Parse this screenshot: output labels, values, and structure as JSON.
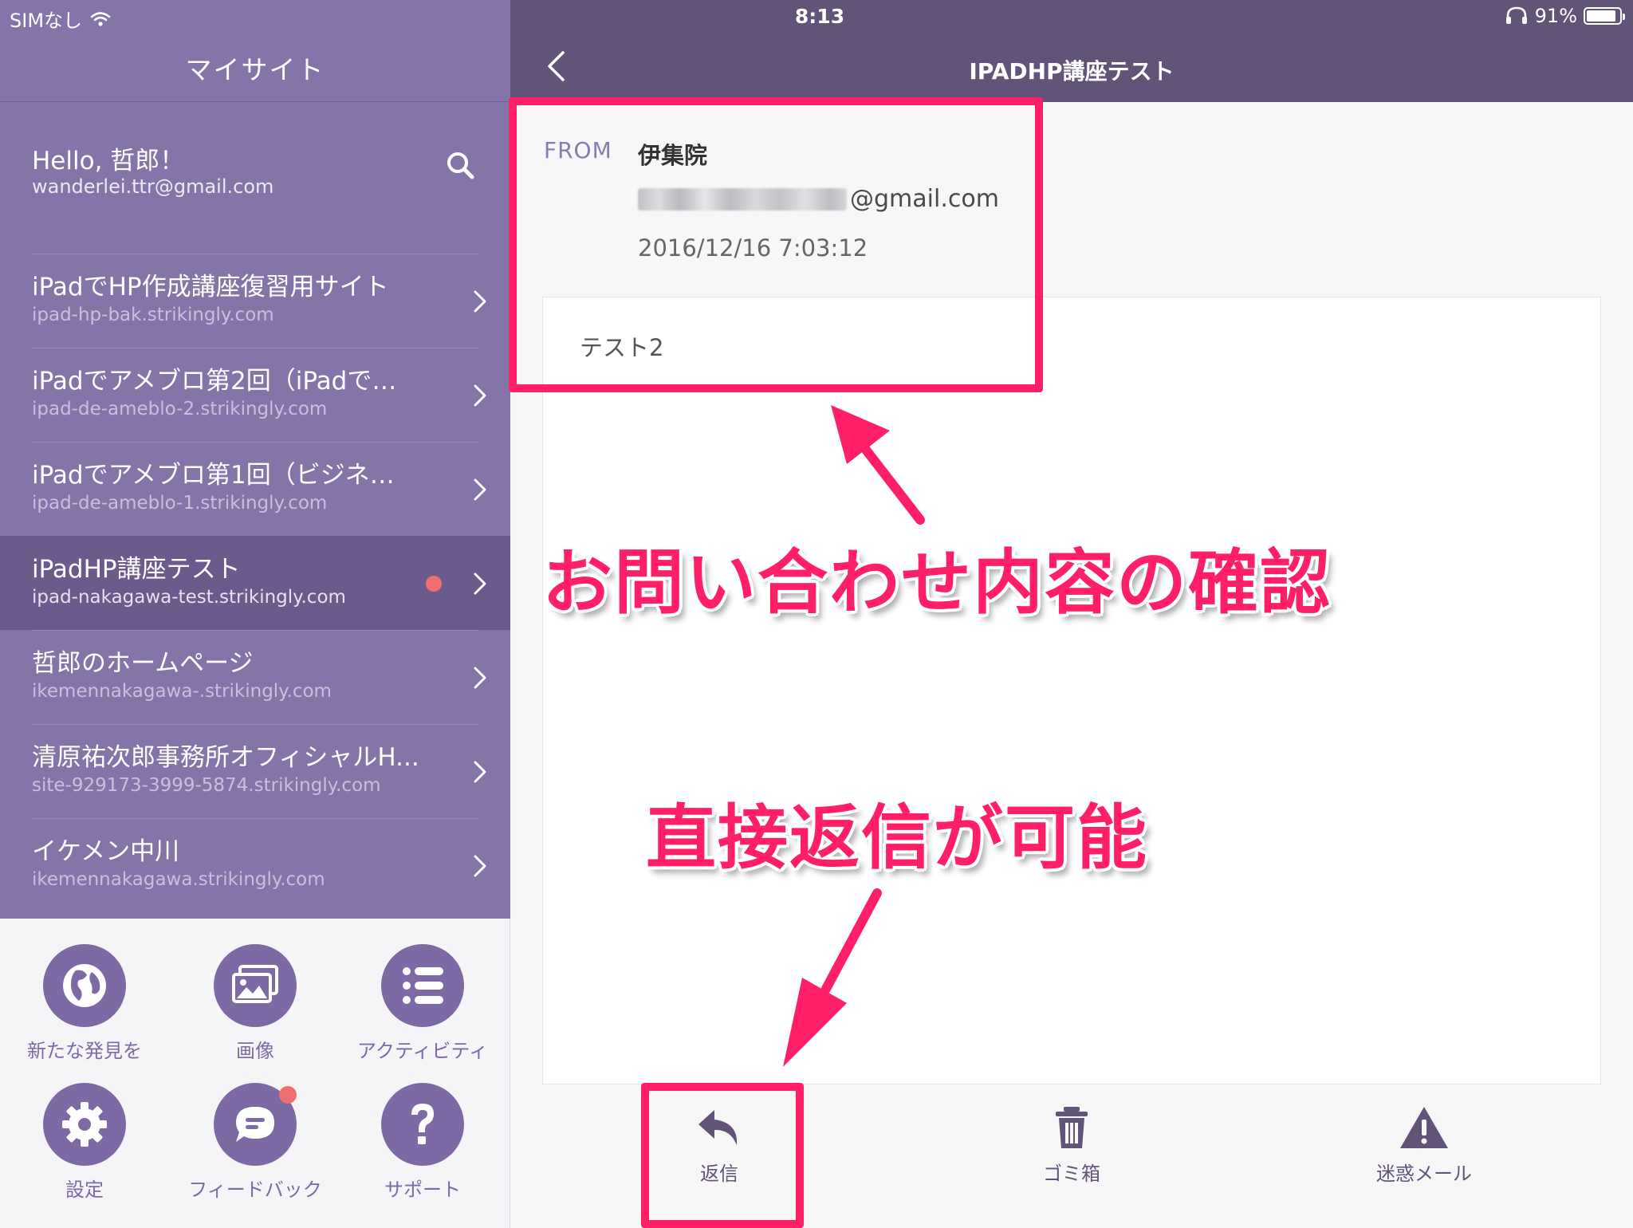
{
  "status": {
    "carrier": "SIMなし",
    "time": "8:13",
    "battery": "91%",
    "battery_fraction": 0.91
  },
  "sidebar": {
    "title": "マイサイト",
    "greeting": "Hello, 哲郎！",
    "email": "wanderlei.ttr@gmail.com",
    "sites": [
      {
        "name": "iPadでHP作成講座復習用サイト",
        "url": "ipad-hp-bak.strikingly.com",
        "active": false,
        "notify": false
      },
      {
        "name": "iPadでアメブロ第2回（iPadで…",
        "url": "ipad-de-ameblo-2.strikingly.com",
        "active": false,
        "notify": false
      },
      {
        "name": "iPadでアメブロ第1回（ビジネ…",
        "url": "ipad-de-ameblo-1.strikingly.com",
        "active": false,
        "notify": false
      },
      {
        "name": "iPadHP講座テスト",
        "url": "ipad-nakagawa-test.strikingly.com",
        "active": true,
        "notify": true
      },
      {
        "name": "哲郎のホームページ",
        "url": "ikemennakagawa-.strikingly.com",
        "active": false,
        "notify": false
      },
      {
        "name": "清原祐次郎事務所オフィシャルH...",
        "url": "site-929173-3999-5874.strikingly.com",
        "active": false,
        "notify": false
      },
      {
        "name": "イケメン中川",
        "url": "ikemennakagawa.strikingly.com",
        "active": false,
        "notify": false
      }
    ],
    "dock": [
      {
        "label": "新たな発見を",
        "icon": "globe-icon"
      },
      {
        "label": "画像",
        "icon": "images-icon"
      },
      {
        "label": "アクティビティ",
        "icon": "activity-list-icon"
      },
      {
        "label": "設定",
        "icon": "gear-icon"
      },
      {
        "label": "フィードバック",
        "icon": "chat-bubble-icon"
      },
      {
        "label": "サポート",
        "icon": "question-icon"
      }
    ]
  },
  "detail": {
    "title": "IPADHP講座テスト",
    "from_label": "FROM",
    "sender_name": "伊集院",
    "sender_email_suffix": "@gmail.com",
    "date": "2016/12/16 7:03:12",
    "message": "テスト2",
    "actions": [
      {
        "label": "返信",
        "icon": "reply-icon"
      },
      {
        "label": "ゴミ箱",
        "icon": "trash-icon"
      },
      {
        "label": "迷惑メール",
        "icon": "warning-icon"
      }
    ]
  },
  "annotations": {
    "confirm_text": "お問い合わせ内容の確認",
    "reply_text": "直接返信が可能"
  },
  "colors": {
    "accent": "#7d6aa5",
    "sidebar_bg": "#8574a8",
    "topbar_bg": "#625378",
    "notify_dot": "#ef6e6e",
    "annotation": "#ff1f66"
  }
}
